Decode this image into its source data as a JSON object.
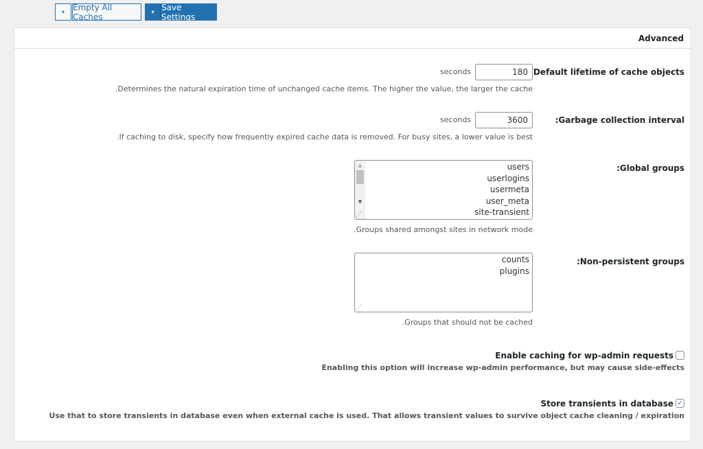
{
  "toolbar": {
    "dropdown_icon": "▾",
    "empty_caches_label": "Empty All Caches",
    "save_settings_label": "Save Settings"
  },
  "panel": {
    "title": "Advanced"
  },
  "settings": {
    "default_lifetime": {
      "label": ":Default lifetime of cache objects",
      "unit": "seconds",
      "value": "180",
      "description": ".Determines the natural expiration time of unchanged cache items. The higher the value, the larger the cache"
    },
    "gc_interval": {
      "label": ":Garbage collection interval",
      "unit": "seconds",
      "value": "3600",
      "description": ".If caching to disk, specify how frequently expired cache data is removed. For busy sites, a lower value is best"
    },
    "global_groups": {
      "label": ":Global groups",
      "lines": [
        "users",
        "userlogins",
        "usermeta",
        "user_meta",
        "site-transient"
      ],
      "description": ".Groups shared amongst sites in network mode"
    },
    "non_persistent_groups": {
      "label": ":Non-persistent groups",
      "lines": [
        "counts",
        "plugins"
      ],
      "description": ".Groups that should not be cached"
    },
    "wp_admin_caching": {
      "label": "Enable caching for wp-admin requests",
      "checked": false,
      "description": "Enabling this option will increase wp-admin performance, but may cause side-effects"
    },
    "store_transients": {
      "label": "Store transients in database",
      "checked": true,
      "check_glyph": "✓",
      "description": "Use that to store transients in database even when external cache is used. That allows transient values to survive object cache cleaning / expiration"
    }
  },
  "icons": {
    "scroll_up": "▲",
    "scroll_down": "▼",
    "resize_grip": "⋰"
  }
}
